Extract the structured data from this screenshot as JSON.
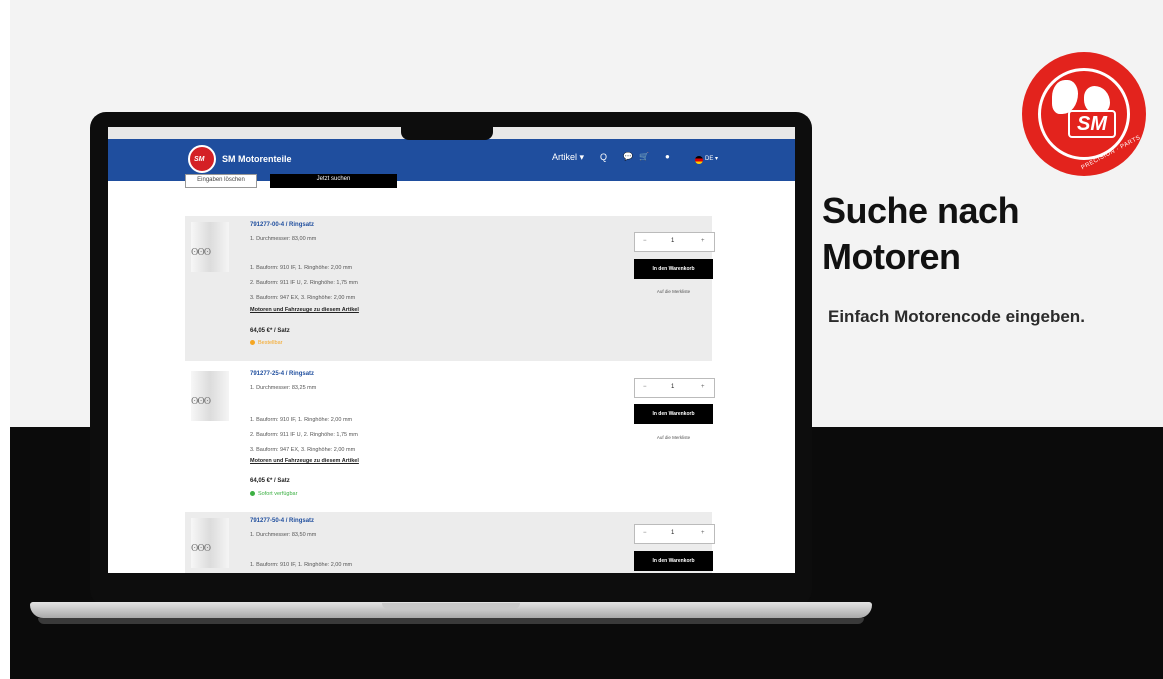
{
  "colors": {
    "brand_red": "#e3231d",
    "header_blue": "#1f4e9e",
    "background_dark": "#0b0b0b"
  },
  "brand": {
    "badge": "SM",
    "tagline": "PRECISION · PARTS"
  },
  "headline": {
    "line1": "Suche nach",
    "line2": "Motoren"
  },
  "subline": "Einfach Motorencode eingeben.",
  "site": {
    "name": "SM Motorenteile",
    "logo_text": "SM",
    "nav": {
      "articles": "Artikel ▾",
      "search_icon": "Q",
      "chat_icon": "💬",
      "cart_icon": "🛒",
      "account_icon": "●",
      "language": "DE ▾"
    },
    "search": {
      "reset_label": "Eingaben löschen",
      "submit_label": "Jetzt suchen"
    }
  },
  "products": [
    {
      "title": "791277-00-4 / Ringsatz",
      "diameter": "1. Durchmesser: 83,00 mm",
      "ring1": "1. Bauform: 910 IF, 1. Ringhöhe: 2,00 mm",
      "ring2": "2. Bauform: 911 IF U, 2. Ringhöhe: 1,75 mm",
      "ring3": "3. Bauform: 947 EX, 3. Ringhöhe: 2,00 mm",
      "link": "Motoren und Fahrzeuge zu diesem Artikel",
      "price": "64,05 €* / Satz",
      "status": "Bestellbar",
      "status_color": "#f5a623",
      "qty": "1",
      "cart_label": "In den Warenkorb",
      "wishlist_label": "Auf die Merkliste"
    },
    {
      "title": "791277-25-4 / Ringsatz",
      "diameter": "1. Durchmesser: 83,25 mm",
      "ring1": "1. Bauform: 910 IF, 1. Ringhöhe: 2,00 mm",
      "ring2": "2. Bauform: 911 IF U, 2. Ringhöhe: 1,75 mm",
      "ring3": "3. Bauform: 947 EX, 3. Ringhöhe: 2,00 mm",
      "link": "Motoren und Fahrzeuge zu diesem Artikel",
      "price": "64,05 €* / Satz",
      "status": "Sofort verfügbar",
      "status_color": "#3cb043",
      "qty": "1",
      "cart_label": "In den Warenkorb",
      "wishlist_label": "Auf die Merkliste"
    },
    {
      "title": "791277-50-4 / Ringsatz",
      "diameter": "1. Durchmesser: 83,50 mm",
      "ring1": "1. Bauform: 910 IF, 1. Ringhöhe: 2,00 mm",
      "qty": "1",
      "cart_label": "In den Warenkorb"
    }
  ],
  "qty_controls": {
    "minus": "−",
    "plus": "+"
  }
}
